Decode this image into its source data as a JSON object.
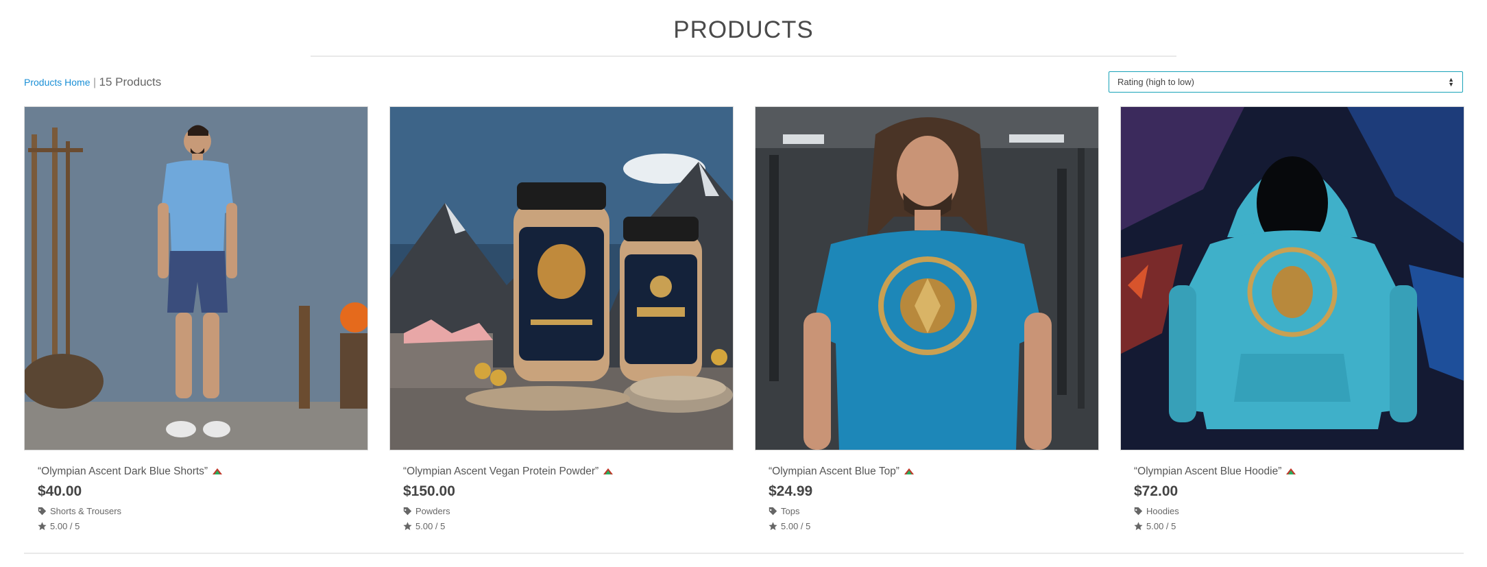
{
  "page": {
    "title": "PRODUCTS"
  },
  "breadcrumb": {
    "home_label": "Products Home",
    "separator": "|",
    "count_label": "15 Products"
  },
  "sort": {
    "selected": "Rating (high to low)"
  },
  "colors": {
    "link": "#1a8fd6",
    "select_border": "#17a2b8"
  },
  "products": [
    {
      "name": "“Olympian Ascent Dark Blue Shorts”",
      "price": "$40.00",
      "category": "Shorts & Trousers",
      "rating": "5.00 / 5",
      "icon": "olympus-hat-icon"
    },
    {
      "name": "“Olympian Ascent Vegan Protein Powder”",
      "price": "$150.00",
      "category": "Powders",
      "rating": "5.00 / 5",
      "icon": "olympus-hat-icon"
    },
    {
      "name": "“Olympian Ascent Blue Top”",
      "price": "$24.99",
      "category": "Tops",
      "rating": "5.00 / 5",
      "icon": "olympus-hat-icon"
    },
    {
      "name": "“Olympian Ascent Blue Hoodie”",
      "price": "$72.00",
      "category": "Hoodies",
      "rating": "5.00 / 5",
      "icon": "olympus-hat-icon"
    }
  ]
}
